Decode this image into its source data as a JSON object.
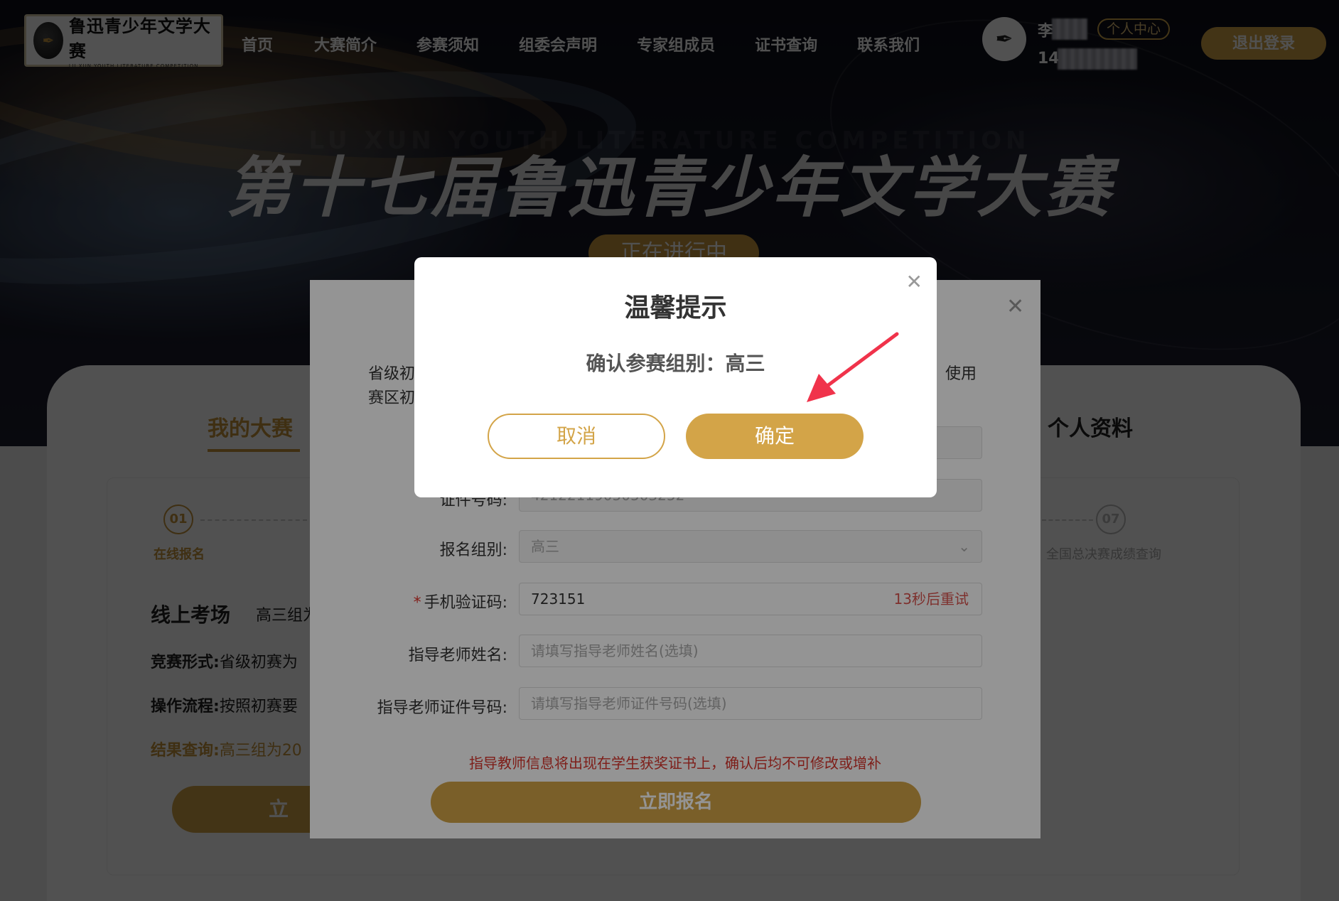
{
  "nav": {
    "logo_cn": "鲁迅青少年文学大赛",
    "logo_en": "LU XUN YOUTH LITERATURE COMPETITION",
    "items": [
      "首页",
      "大赛简介",
      "参赛须知",
      "组委会声明",
      "专家组成员",
      "证书查询",
      "联系我们"
    ],
    "user_name": "李",
    "user_id": "14",
    "center_link": "个人中心",
    "logout": "退出登录"
  },
  "hero": {
    "title": "第十七届鲁迅青少年文学大赛",
    "subtitle_en": "LU XUN YOUTH LITERATURE COMPETITION",
    "status": "正在进行中"
  },
  "page": {
    "tab_my": "我的大赛",
    "tab_profile": "个人资料",
    "steps": [
      {
        "num": "01",
        "label": "在线报名"
      },
      {
        "num": "07",
        "label": "全国总决赛成绩查询"
      }
    ],
    "exam_title": "线上考场",
    "exam_group": "高三组为",
    "form_label": "竞赛形式:",
    "form_value": "省级初赛为",
    "flow_label": "操作流程:",
    "flow_value": "按照初赛要",
    "result_label": "结果查询:",
    "result_value": "高三组为20",
    "bg_button": "立"
  },
  "registration": {
    "note_line1": "省级初",
    "note_line2": "赛区初",
    "note_tail": "使用",
    "id_label": "证件号码:",
    "id_value": "42122119050503252",
    "group_label": "报名组别:",
    "group_value": "高三",
    "sms_label": "手机验证码:",
    "sms_value": "723151",
    "sms_retry": "13秒后重试",
    "teacher_name_label": "指导老师姓名:",
    "teacher_name_placeholder": "请填写指导老师姓名(选填)",
    "teacher_id_label": "指导老师证件号码:",
    "teacher_id_placeholder": "请填写指导老师证件号码(选填)",
    "warning": "指导教师信息将出现在学生获奖证书上，确认后均不可修改或增补",
    "submit": "立即报名"
  },
  "dialog": {
    "title": "温馨提示",
    "message": "确认参赛组别：高三",
    "cancel": "取消",
    "confirm": "确定"
  },
  "colors": {
    "accent_gold": "#d3a448",
    "warning_red": "#d9342c",
    "annotation_arrow": "#f0334b"
  }
}
